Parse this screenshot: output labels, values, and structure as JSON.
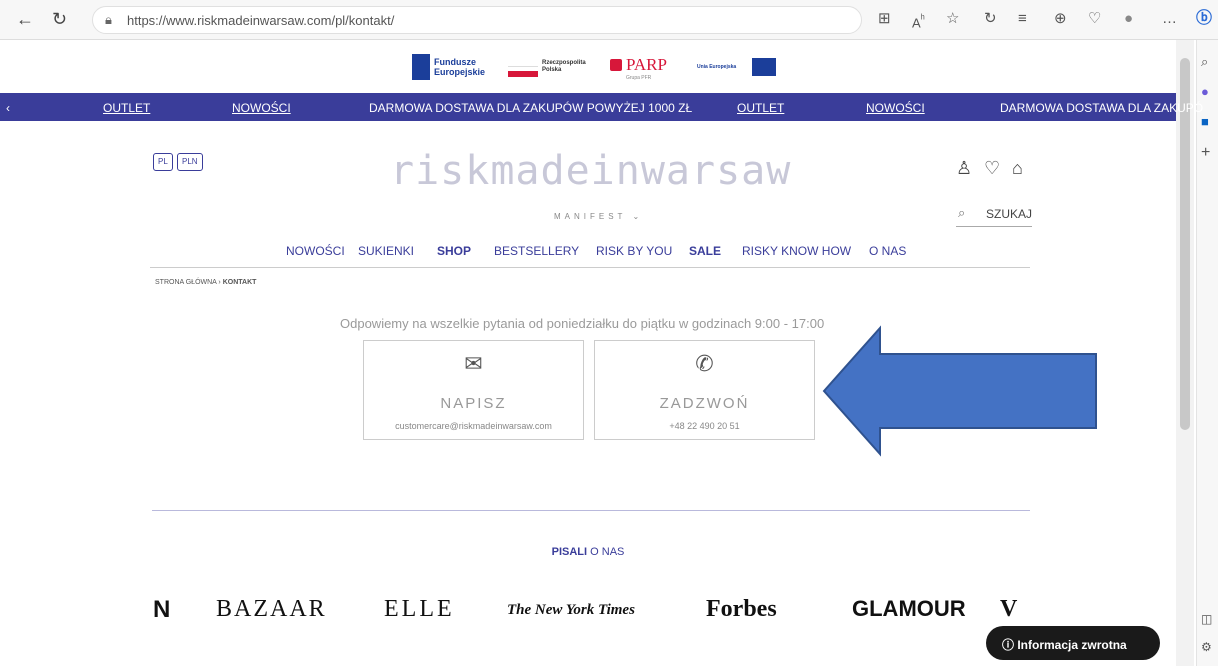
{
  "browser": {
    "url": "https://www.riskmadeinwarsaw.com/pl/kontakt/",
    "back_icon": "arrow-left",
    "refresh_icon": "refresh",
    "icons": [
      "⊞",
      "Aʰ",
      "☆",
      "↻",
      "⋮",
      "♡",
      "⊕",
      "●",
      "…"
    ]
  },
  "funding": {
    "fundusze": "Fundusze Europejskie",
    "rzeczpospolita": "Rzeczpospolita Polska",
    "parp": "PARP",
    "parp_sub": "Grupa PFR",
    "unia": "Unia Europejska"
  },
  "promo": {
    "items": [
      "OUTLET",
      "NOWOŚCI",
      "DARMOWA DOSTAWA DLA ZAKUPÓW POWYŻEJ 1000 ZŁ",
      "OUTLET",
      "NOWOŚCI",
      "DARMOWA DOSTAWA DLA ZAKUPÓ"
    ],
    "color": "#3a3d9a"
  },
  "header": {
    "lang": "PL",
    "currency": "PLN",
    "logo": "riskmadeinwarsaw",
    "manifest": "MANIFEST",
    "search_label": "SZUKAJ"
  },
  "nav": {
    "items": [
      "NOWOŚCI",
      "SUKIENKI",
      "SHOP",
      "BESTSELLERY",
      "RISK BY YOU",
      "SALE",
      "RISKY KNOW HOW",
      "O NAS"
    ]
  },
  "breadcrumb": {
    "home": "STRONA GŁÓWNA",
    "current": "KONTAKT"
  },
  "contact": {
    "info": "Odpowiemy na wszelkie pytania od poniedziałku do piątku w godzinach 9:00 - 17:00",
    "write_title": "NAPISZ",
    "write_value": "customercare@riskmadeinwarsaw.com",
    "call_title": "ZADZWOŃ",
    "call_value": "+48 22 490 20 51"
  },
  "press": {
    "heading_bold": "PISALI",
    "heading_rest": "O NAS",
    "logos": [
      "N",
      "BAZAAR",
      "ELLE",
      "The New York Times",
      "Forbes",
      "GLAMOUR",
      "V"
    ]
  },
  "feedback": {
    "label": "Informacja zwrotna"
  },
  "annotation": {
    "arrow_color": "#4472c4"
  }
}
